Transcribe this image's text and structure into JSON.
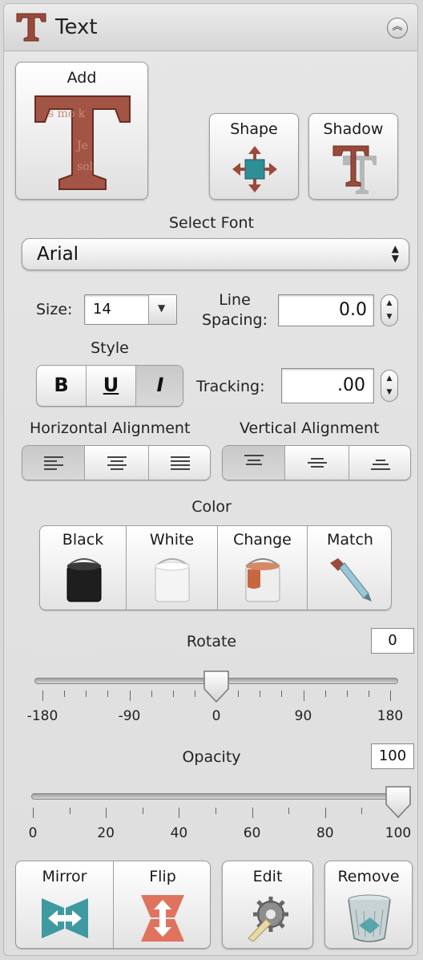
{
  "panel": {
    "title": "Text",
    "collapse_icon": "chevron-up-double-icon"
  },
  "buttons": {
    "add": "Add",
    "shape": "Shape",
    "shadow": "Shadow"
  },
  "font": {
    "label": "Select Font",
    "selected": "Arial"
  },
  "size": {
    "label": "Size:",
    "value": "14"
  },
  "line_spacing": {
    "label_line1": "Line",
    "label_line2": "Spacing:",
    "value": "0.0"
  },
  "style": {
    "label": "Style",
    "bold": "B",
    "underline": "U",
    "italic": "I",
    "active": "italic"
  },
  "tracking": {
    "label": "Tracking:",
    "value": ".00"
  },
  "alignment": {
    "horizontal_label": "Horizontal Alignment",
    "vertical_label": "Vertical Alignment",
    "horizontal_selected": "left",
    "vertical_selected": "top"
  },
  "color": {
    "label": "Color",
    "black": "Black",
    "white": "White",
    "change": "Change",
    "match": "Match"
  },
  "rotate": {
    "label": "Rotate",
    "value": "0",
    "min": -180,
    "max": 180,
    "current": 0,
    "tick_labels": [
      "-180",
      "-90",
      "0",
      "90",
      "180"
    ]
  },
  "opacity": {
    "label": "Opacity",
    "value": "100",
    "min": 0,
    "max": 100,
    "current": 100,
    "tick_labels": [
      "0",
      "20",
      "40",
      "60",
      "80",
      "100"
    ]
  },
  "actions": {
    "mirror": "Mirror",
    "flip": "Flip",
    "edit": "Edit",
    "remove": "Remove"
  },
  "colors": {
    "brand_red": "#9a4a3a",
    "teal": "#3e9aa0",
    "salmon": "#e0735e"
  }
}
